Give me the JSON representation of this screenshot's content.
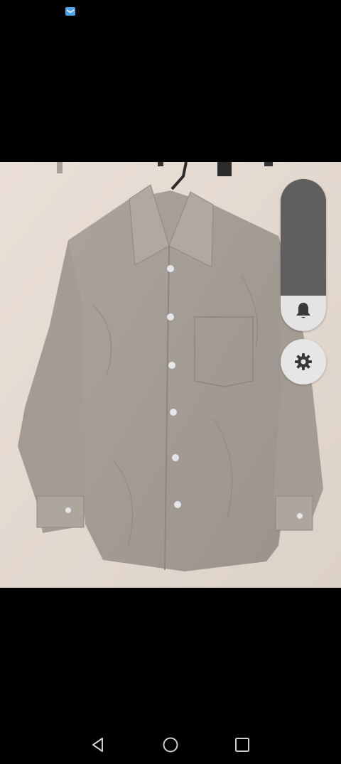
{
  "status_bar": {
    "notification_icon": "mail-notification-icon"
  },
  "photo": {
    "subject": "shirt-photo"
  },
  "volume_panel": {
    "level": 0.14,
    "icon": "bell-icon",
    "track_color": "#5f5f5f",
    "fill_color": "#e4e4e4"
  },
  "settings_button": {
    "icon": "gear-icon"
  },
  "nav_bar": {
    "back_icon": "back-triangle-icon",
    "home_icon": "home-circle-icon",
    "recents_icon": "recents-square-icon"
  }
}
